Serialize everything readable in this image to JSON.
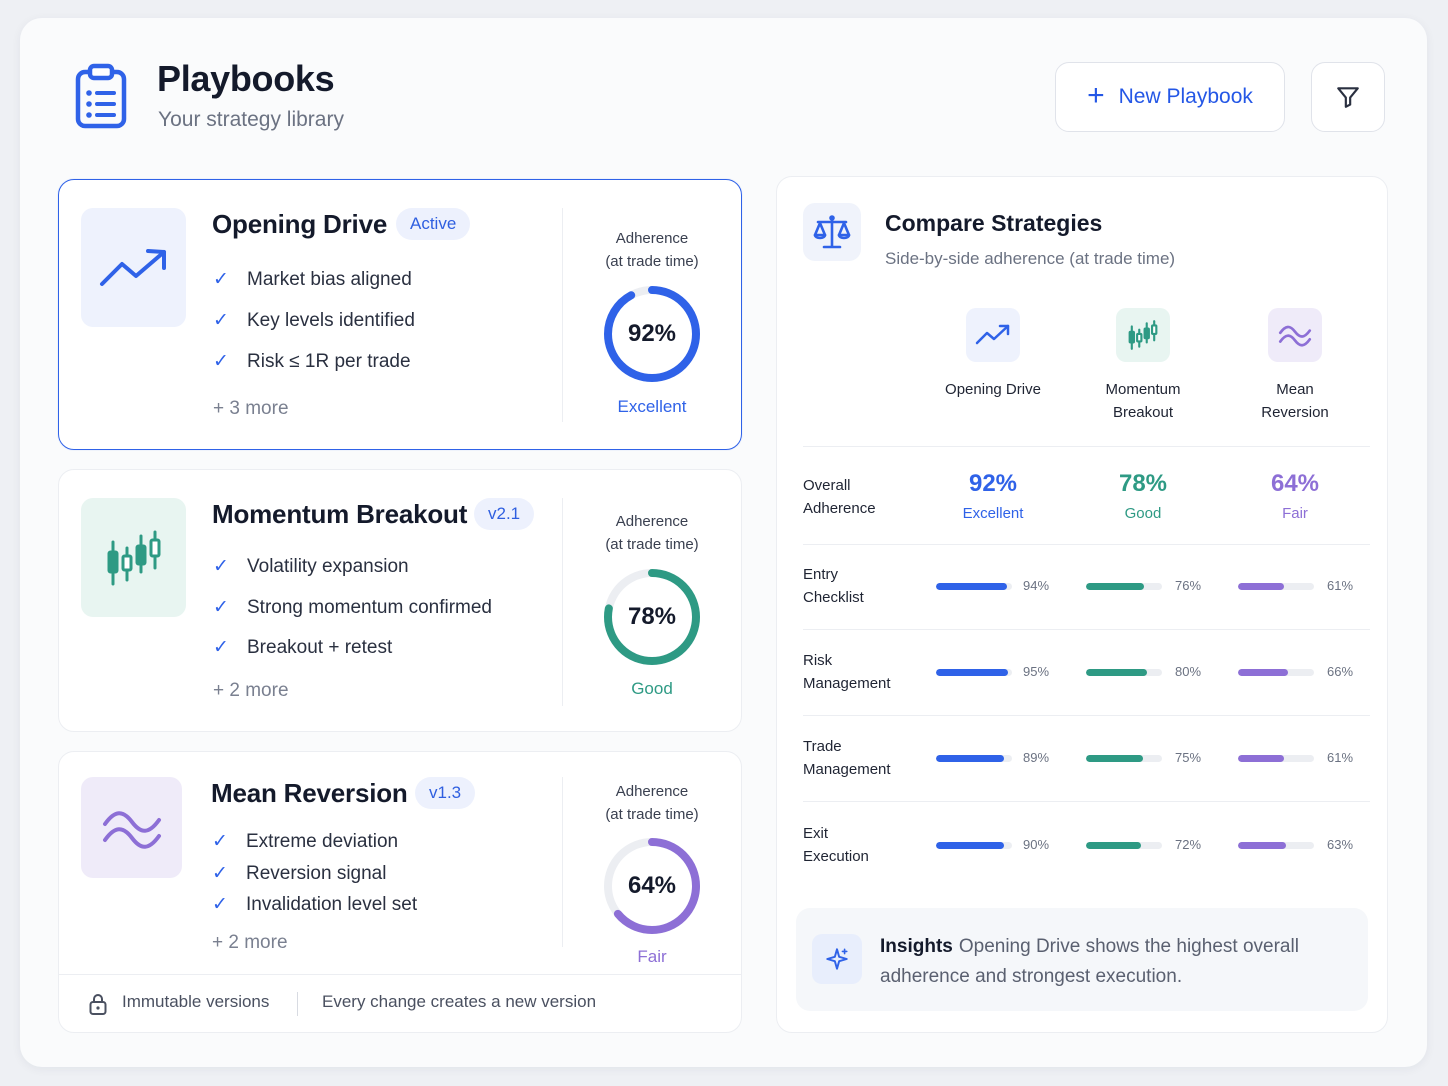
{
  "header": {
    "title": "Playbooks",
    "subtitle": "Your strategy library",
    "icon": "clipboard-list-icon",
    "new_button": "New Playbook",
    "new_button_icon": "plus-icon",
    "filter_icon": "filter-icon"
  },
  "playbooks": [
    {
      "name": "Opening Drive",
      "badge": "Active",
      "icon": "trend-up-icon",
      "criteria": [
        "Market bias aligned",
        "Key levels identified",
        "Risk ≤ 1R per trade"
      ],
      "more": "+ 3 more",
      "adherence_label_1": "Adherence",
      "adherence_label_2": "(at trade time)",
      "adherence": 92,
      "adherence_text": "92%",
      "rating": "Excellent",
      "color": "#2f62e8"
    },
    {
      "name": "Momentum Breakout",
      "badge": "v2.1",
      "icon": "candlestick-icon",
      "criteria": [
        "Volatility expansion",
        "Strong momentum confirmed",
        "Breakout + retest"
      ],
      "more": "+ 2 more",
      "adherence_label_1": "Adherence",
      "adherence_label_2": "(at trade time)",
      "adherence": 78,
      "adherence_text": "78%",
      "rating": "Good",
      "color": "#2e9a84"
    },
    {
      "name": "Mean Reversion",
      "badge": "v1.3",
      "icon": "wave-icon",
      "criteria": [
        "Extreme deviation",
        "Reversion signal",
        "Invalidation level set"
      ],
      "more": "+ 2 more",
      "adherence_label_1": "Adherence",
      "adherence_label_2": "(at trade time)",
      "adherence": 64,
      "adherence_text": "64%",
      "rating": "Fair",
      "color": "#8d6fd6"
    }
  ],
  "footer": {
    "lock_icon": "lock-icon",
    "immutable": "Immutable versions",
    "note": "Every change creates a new version"
  },
  "compare": {
    "title": "Compare Strategies",
    "subtitle": "Side-by-side adherence (at trade time)",
    "icon": "scale-icon",
    "columns": [
      {
        "name_1": "Opening Drive",
        "name_2": "",
        "icon": "trend-up-icon"
      },
      {
        "name_1": "Momentum",
        "name_2": "Breakout",
        "icon": "candlestick-icon"
      },
      {
        "name_1": "Mean",
        "name_2": "Reversion",
        "icon": "wave-icon"
      }
    ],
    "overall": {
      "label_1": "Overall",
      "label_2": "Adherence",
      "values": [
        "92%",
        "78%",
        "64%"
      ],
      "ratings": [
        "Excellent",
        "Good",
        "Fair"
      ]
    },
    "rows": [
      {
        "label_1": "Entry",
        "label_2": "Checklist",
        "values": [
          94,
          76,
          61
        ],
        "texts": [
          "94%",
          "76%",
          "61%"
        ]
      },
      {
        "label_1": "Risk",
        "label_2": "Management",
        "values": [
          95,
          80,
          66
        ],
        "texts": [
          "95%",
          "80%",
          "66%"
        ]
      },
      {
        "label_1": "Trade",
        "label_2": "Management",
        "values": [
          89,
          75,
          61
        ],
        "texts": [
          "89%",
          "75%",
          "61%"
        ]
      },
      {
        "label_1": "Exit",
        "label_2": "Execution",
        "values": [
          90,
          72,
          63
        ],
        "texts": [
          "90%",
          "72%",
          "63%"
        ]
      }
    ],
    "colors": [
      "#2f62e8",
      "#2e9a84",
      "#8d6fd6"
    ]
  },
  "insight": {
    "icon": "sparkle-icon",
    "title": "Insights",
    "text": "Opening Drive shows the highest overall adherence and strongest execution."
  }
}
